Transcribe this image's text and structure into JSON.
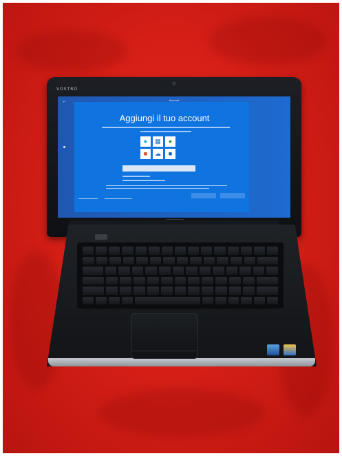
{
  "laptop": {
    "brand": "VOSTRO"
  },
  "setup_screen": {
    "header": "Account",
    "title": "Aggiungi il tuo account"
  }
}
